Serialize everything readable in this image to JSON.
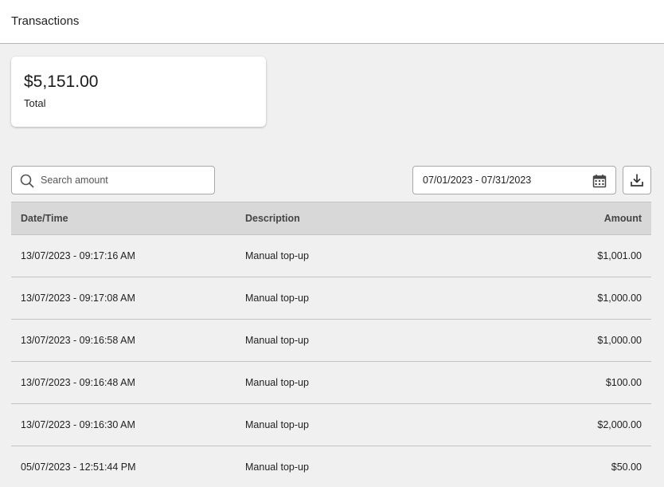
{
  "header": {
    "title": "Transactions"
  },
  "summary": {
    "amount": "$5,151.00",
    "label": "Total"
  },
  "toolbar": {
    "search_placeholder": "Search amount",
    "search_icon": "search-icon",
    "date_range": "07/01/2023 - 07/31/2023",
    "calendar_icon": "calendar-icon",
    "download_icon": "download-icon"
  },
  "table": {
    "columns": [
      "Date/Time",
      "Description",
      "Amount"
    ],
    "rows": [
      [
        "13/07/2023 - 09:17:16 AM",
        "Manual top-up",
        "$1,001.00"
      ],
      [
        "13/07/2023 - 09:17:08 AM",
        "Manual top-up",
        "$1,000.00"
      ],
      [
        "13/07/2023 - 09:16:58 AM",
        "Manual top-up",
        "$1,000.00"
      ],
      [
        "13/07/2023 - 09:16:48 AM",
        "Manual top-up",
        "$100.00"
      ],
      [
        "13/07/2023 - 09:16:30 AM",
        "Manual top-up",
        "$2,000.00"
      ],
      [
        "05/07/2023 - 12:51:44 PM",
        "Manual top-up",
        "$50.00"
      ]
    ]
  }
}
